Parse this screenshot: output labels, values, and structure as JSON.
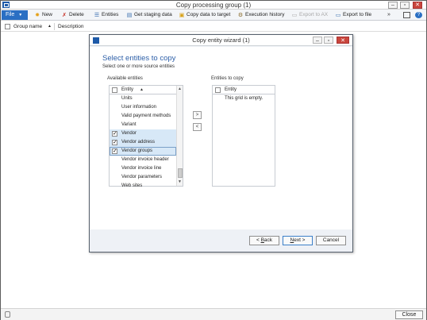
{
  "window": {
    "title": "Copy processing group (1)"
  },
  "toolbar": {
    "file_label": "File",
    "new_label": "New",
    "delete_label": "Delete",
    "entities_label": "Entities",
    "staging_label": "Get staging data",
    "copy_label": "Copy data to target",
    "history_label": "Execution history",
    "export_ax_label": "Export to AX",
    "export_file_label": "Export to file",
    "more_label": "»"
  },
  "grid": {
    "columns": [
      "Group name",
      "Description"
    ],
    "sort_glyph": "▲"
  },
  "dialog": {
    "title": "Copy entity wizard (1)",
    "heading": "Select entities to copy",
    "subheading": "Select one or more source entities",
    "available": {
      "label": "Available entities",
      "column": "Entity",
      "rows": [
        {
          "name": "Units",
          "checked": false,
          "selected": false
        },
        {
          "name": "User information",
          "checked": false,
          "selected": false
        },
        {
          "name": "Valid payment methods",
          "checked": false,
          "selected": false
        },
        {
          "name": "Variant",
          "checked": false,
          "selected": false
        },
        {
          "name": "Vendor",
          "checked": true,
          "selected": true
        },
        {
          "name": "Vendor address",
          "checked": true,
          "selected": true
        },
        {
          "name": "Vendor groups",
          "checked": true,
          "selected": true
        },
        {
          "name": "Vendor invoice header",
          "checked": false,
          "selected": false
        },
        {
          "name": "Vendor invoice line",
          "checked": false,
          "selected": false
        },
        {
          "name": "Vendor parameters",
          "checked": false,
          "selected": false
        },
        {
          "name": "Web sites",
          "checked": false,
          "selected": false
        }
      ]
    },
    "target": {
      "label": "Entities to copy",
      "column": "Entity",
      "empty_text": "This grid is empty."
    },
    "move_right": ">",
    "move_left": "<",
    "back_underline": "B",
    "back_rest": "ack",
    "back_prefix": "< ",
    "next_underline": "N",
    "next_rest": "ext >",
    "cancel_label": "Cancel"
  },
  "status": {
    "close_label": "Close"
  },
  "colors": {
    "accent": "#2a6fc3",
    "heading": "#2d5fa8",
    "selection": "#d7e8f7",
    "close_red": "#c9463d"
  }
}
